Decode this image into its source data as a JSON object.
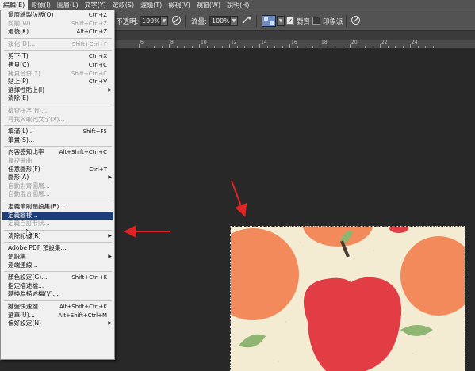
{
  "menubar": {
    "items": [
      {
        "label": "編輯(E)",
        "active": true
      },
      {
        "label": "影像(I)",
        "active": false
      },
      {
        "label": "圖層(L)",
        "active": false
      },
      {
        "label": "文字(Y)",
        "active": false
      },
      {
        "label": "選取(S)",
        "active": false
      },
      {
        "label": "濾鏡(T)",
        "active": false
      },
      {
        "label": "檢視(V)",
        "active": false
      },
      {
        "label": "視窗(W)",
        "active": false
      },
      {
        "label": "說明(H)",
        "active": false
      }
    ]
  },
  "options": {
    "opacity_label": "不透明:",
    "opacity_value": "100%",
    "flow_label": "流量:",
    "flow_value": "100%",
    "aligned_label": "對齊",
    "aligned_checked": true,
    "impressionist_label": "印象派",
    "impressionist_checked": false
  },
  "ruler": {
    "numbers": [
      "6",
      "8",
      "10",
      "12",
      "14",
      "16",
      "18",
      "20",
      "22",
      "24"
    ]
  },
  "edit_menu": {
    "items": [
      {
        "label": "還原繪製仿版(O)",
        "shortcut": "Ctrl+Z",
        "disabled": false
      },
      {
        "label": "向前(W)",
        "shortcut": "Shift+Ctrl+Z",
        "disabled": true
      },
      {
        "label": "退後(K)",
        "shortcut": "Alt+Ctrl+Z",
        "disabled": false
      },
      {
        "sep": true
      },
      {
        "label": "淡化(D)...",
        "shortcut": "Shift+Ctrl+F",
        "disabled": true
      },
      {
        "sep": true
      },
      {
        "label": "剪下(T)",
        "shortcut": "Ctrl+X",
        "disabled": false
      },
      {
        "label": "拷貝(C)",
        "shortcut": "Ctrl+C",
        "disabled": false
      },
      {
        "label": "拷貝合併(Y)",
        "shortcut": "Shift+Ctrl+C",
        "disabled": true
      },
      {
        "label": "貼上(P)",
        "shortcut": "Ctrl+V",
        "disabled": false
      },
      {
        "label": "選擇性貼上(I)",
        "shortcut": "",
        "submenu": true,
        "disabled": false
      },
      {
        "label": "清除(E)",
        "shortcut": "",
        "disabled": false
      },
      {
        "sep": true
      },
      {
        "label": "檢查拼字(H)...",
        "shortcut": "",
        "disabled": true
      },
      {
        "label": "尋找與取代文字(X)...",
        "shortcut": "",
        "disabled": true
      },
      {
        "sep": true
      },
      {
        "label": "填滿(L)...",
        "shortcut": "Shift+F5",
        "disabled": false
      },
      {
        "label": "筆畫(S)...",
        "shortcut": "",
        "disabled": false
      },
      {
        "sep": true
      },
      {
        "label": "內容感知比率",
        "shortcut": "Alt+Shift+Ctrl+C",
        "disabled": false
      },
      {
        "label": "操控彎曲",
        "shortcut": "",
        "disabled": true
      },
      {
        "label": "任意變形(F)",
        "shortcut": "Ctrl+T",
        "disabled": false
      },
      {
        "label": "變形(A)",
        "shortcut": "",
        "submenu": true,
        "disabled": false
      },
      {
        "label": "自動對齊圖層...",
        "shortcut": "",
        "disabled": true
      },
      {
        "label": "自動混合圖層...",
        "shortcut": "",
        "disabled": true
      },
      {
        "sep": true
      },
      {
        "label": "定義筆刷預設集(B)...",
        "shortcut": "",
        "disabled": false
      },
      {
        "label": "定義圖樣...",
        "shortcut": "",
        "disabled": false,
        "highlight": true
      },
      {
        "label": "定義自訂形狀...",
        "shortcut": "",
        "disabled": true
      },
      {
        "sep": true
      },
      {
        "label": "清除記憶(R)",
        "shortcut": "",
        "submenu": true,
        "disabled": false
      },
      {
        "sep": true
      },
      {
        "label": "Adobe PDF 預設集...",
        "shortcut": "",
        "disabled": false
      },
      {
        "label": "預設集",
        "shortcut": "",
        "submenu": true,
        "disabled": false
      },
      {
        "label": "遠端連線...",
        "shortcut": "",
        "disabled": false
      },
      {
        "sep": true
      },
      {
        "label": "顏色設定(G)...",
        "shortcut": "Shift+Ctrl+K",
        "disabled": false
      },
      {
        "label": "指定描述檔...",
        "shortcut": "",
        "disabled": false
      },
      {
        "label": "轉換為描述檔(V)...",
        "shortcut": "",
        "disabled": false
      },
      {
        "sep": true
      },
      {
        "label": "鍵盤快速鍵...",
        "shortcut": "Alt+Shift+Ctrl+K",
        "disabled": false
      },
      {
        "label": "選單(U)...",
        "shortcut": "Alt+Shift+Ctrl+M",
        "disabled": false
      },
      {
        "label": "偏好設定(N)",
        "shortcut": "",
        "submenu": true,
        "disabled": false
      }
    ]
  },
  "colors": {
    "menu_highlight": "#1c3d7a",
    "annotation_arrow": "#e02424",
    "apple_red": "#e23c45",
    "orange": "#f28a5b",
    "leaf_green": "#8fb572",
    "canvas_bg": "#f3ecd2"
  },
  "icons": {
    "opacity_pressure": "airbrush-pressure-icon",
    "flow_airbrush": "airbrush-icon",
    "pattern_swatch": "pattern-swatch-icon",
    "pressure_size": "tablet-pressure-icon"
  }
}
